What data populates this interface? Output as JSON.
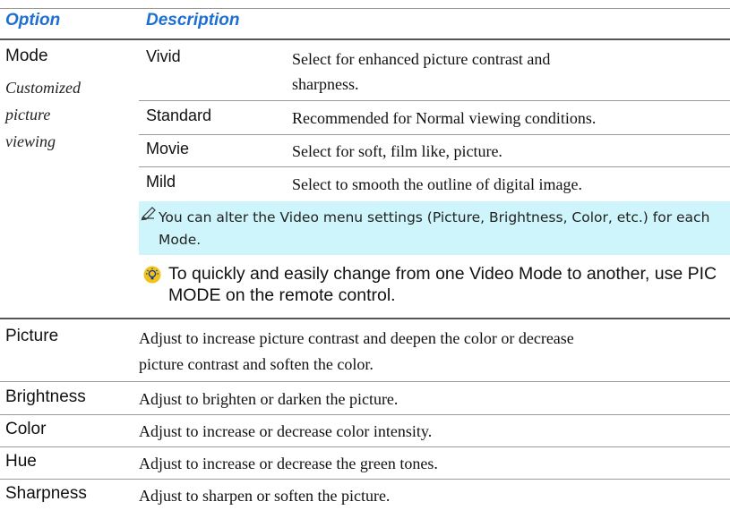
{
  "header": {
    "option": "Option",
    "description": "Description"
  },
  "mode": {
    "label": "Mode",
    "subtitle": [
      "Customized",
      "picture",
      "viewing"
    ],
    "submodes": [
      {
        "name": "Vivid",
        "lines": [
          "Select for enhanced picture contrast and",
          "sharpness."
        ]
      },
      {
        "name": "Standard",
        "lines": [
          "Recommended for Normal viewing conditions."
        ]
      },
      {
        "name": "Movie",
        "lines": [
          "Select for soft, film like, picture."
        ]
      },
      {
        "name": "Mild",
        "lines": [
          "Select to smooth the outline of digital image."
        ]
      }
    ],
    "note": "You can alter the Video menu settings (Picture, Brightness, Color, etc.) for each Mode.",
    "tip": "To quickly and easily change from one Video Mode to another, use PIC MODE on the remote control."
  },
  "rows": [
    {
      "option": "Picture",
      "lines": [
        "Adjust to increase picture contrast and deepen the color or decrease",
        "picture contrast and soften the color."
      ]
    },
    {
      "option": "Brightness",
      "lines": [
        "Adjust to brighten or darken the picture."
      ]
    },
    {
      "option": "Color",
      "lines": [
        "Adjust to increase or decrease color intensity."
      ]
    },
    {
      "option": "Hue",
      "lines": [
        "Adjust to increase or decrease the green tones."
      ]
    },
    {
      "option": "Sharpness",
      "lines": [
        "Adjust to sharpen or soften the picture."
      ]
    }
  ],
  "colors": {
    "header": "#1e6fd0",
    "note_bg": "#cdf5fb",
    "tip_icon": "#f2c21b"
  },
  "icons": {
    "note": "pencil-note-icon",
    "tip": "lightbulb-tip-icon"
  }
}
